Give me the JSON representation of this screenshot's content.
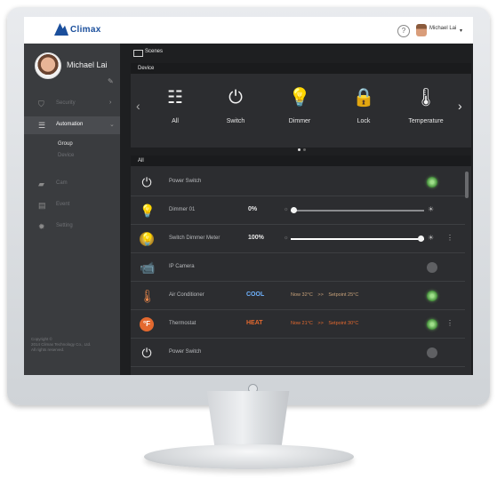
{
  "header": {
    "logo": "Climax",
    "help_icon": "?",
    "user_label": "Michael Lai",
    "caret": "▾"
  },
  "sidebar": {
    "profile_name": "Michael Lai",
    "items": [
      {
        "label": "Security",
        "icon": "shield-icon"
      },
      {
        "label": "Automation",
        "icon": "sliders-icon"
      },
      {
        "label": "Cam",
        "icon": "camera-icon"
      },
      {
        "label": "Event",
        "icon": "event-icon"
      },
      {
        "label": "Setting",
        "icon": "gear-icon"
      }
    ],
    "subitems": [
      "Group",
      "Device"
    ],
    "footer": [
      "Copyright ©",
      "2014 Climax Technology Co., Ltd.",
      "All rights reserved."
    ]
  },
  "scenes": {
    "title": "Scenes",
    "device_panel_title": "Device",
    "devices": [
      {
        "label": "All",
        "icon": "sliders-icon"
      },
      {
        "label": "Switch",
        "icon": "power-icon"
      },
      {
        "label": "Dimmer",
        "icon": "bulb-icon"
      },
      {
        "label": "Lock",
        "icon": "lock-icon"
      },
      {
        "label": "Temperature",
        "icon": "thermometer-icon"
      }
    ]
  },
  "list": {
    "title": "All",
    "rows": [
      {
        "name": "Power Switch",
        "toggle": "on"
      },
      {
        "name": "Dimmer 01",
        "value": "0%",
        "level": 0
      },
      {
        "name": "Switch Dimmer Meter",
        "value": "100%",
        "level": 100
      },
      {
        "name": "IP Camera",
        "toggle": "off"
      },
      {
        "name": "Air Conditioner",
        "mode": "COOL",
        "now": "Now 32°C",
        "sep": ">>",
        "setpoint": "Setpoint 25°C",
        "toggle": "on"
      },
      {
        "name": "Thermostat",
        "mode": "HEAT",
        "now": "Now 21°C",
        "sep": ">>",
        "setpoint": "Setpoint 30°C",
        "toggle": "on"
      },
      {
        "name": "Power Switch",
        "toggle": "off"
      }
    ]
  },
  "colors": {
    "cool": "#6fb3ff",
    "heat": "#e3692f",
    "accent_blue": "#1b4f9c"
  }
}
